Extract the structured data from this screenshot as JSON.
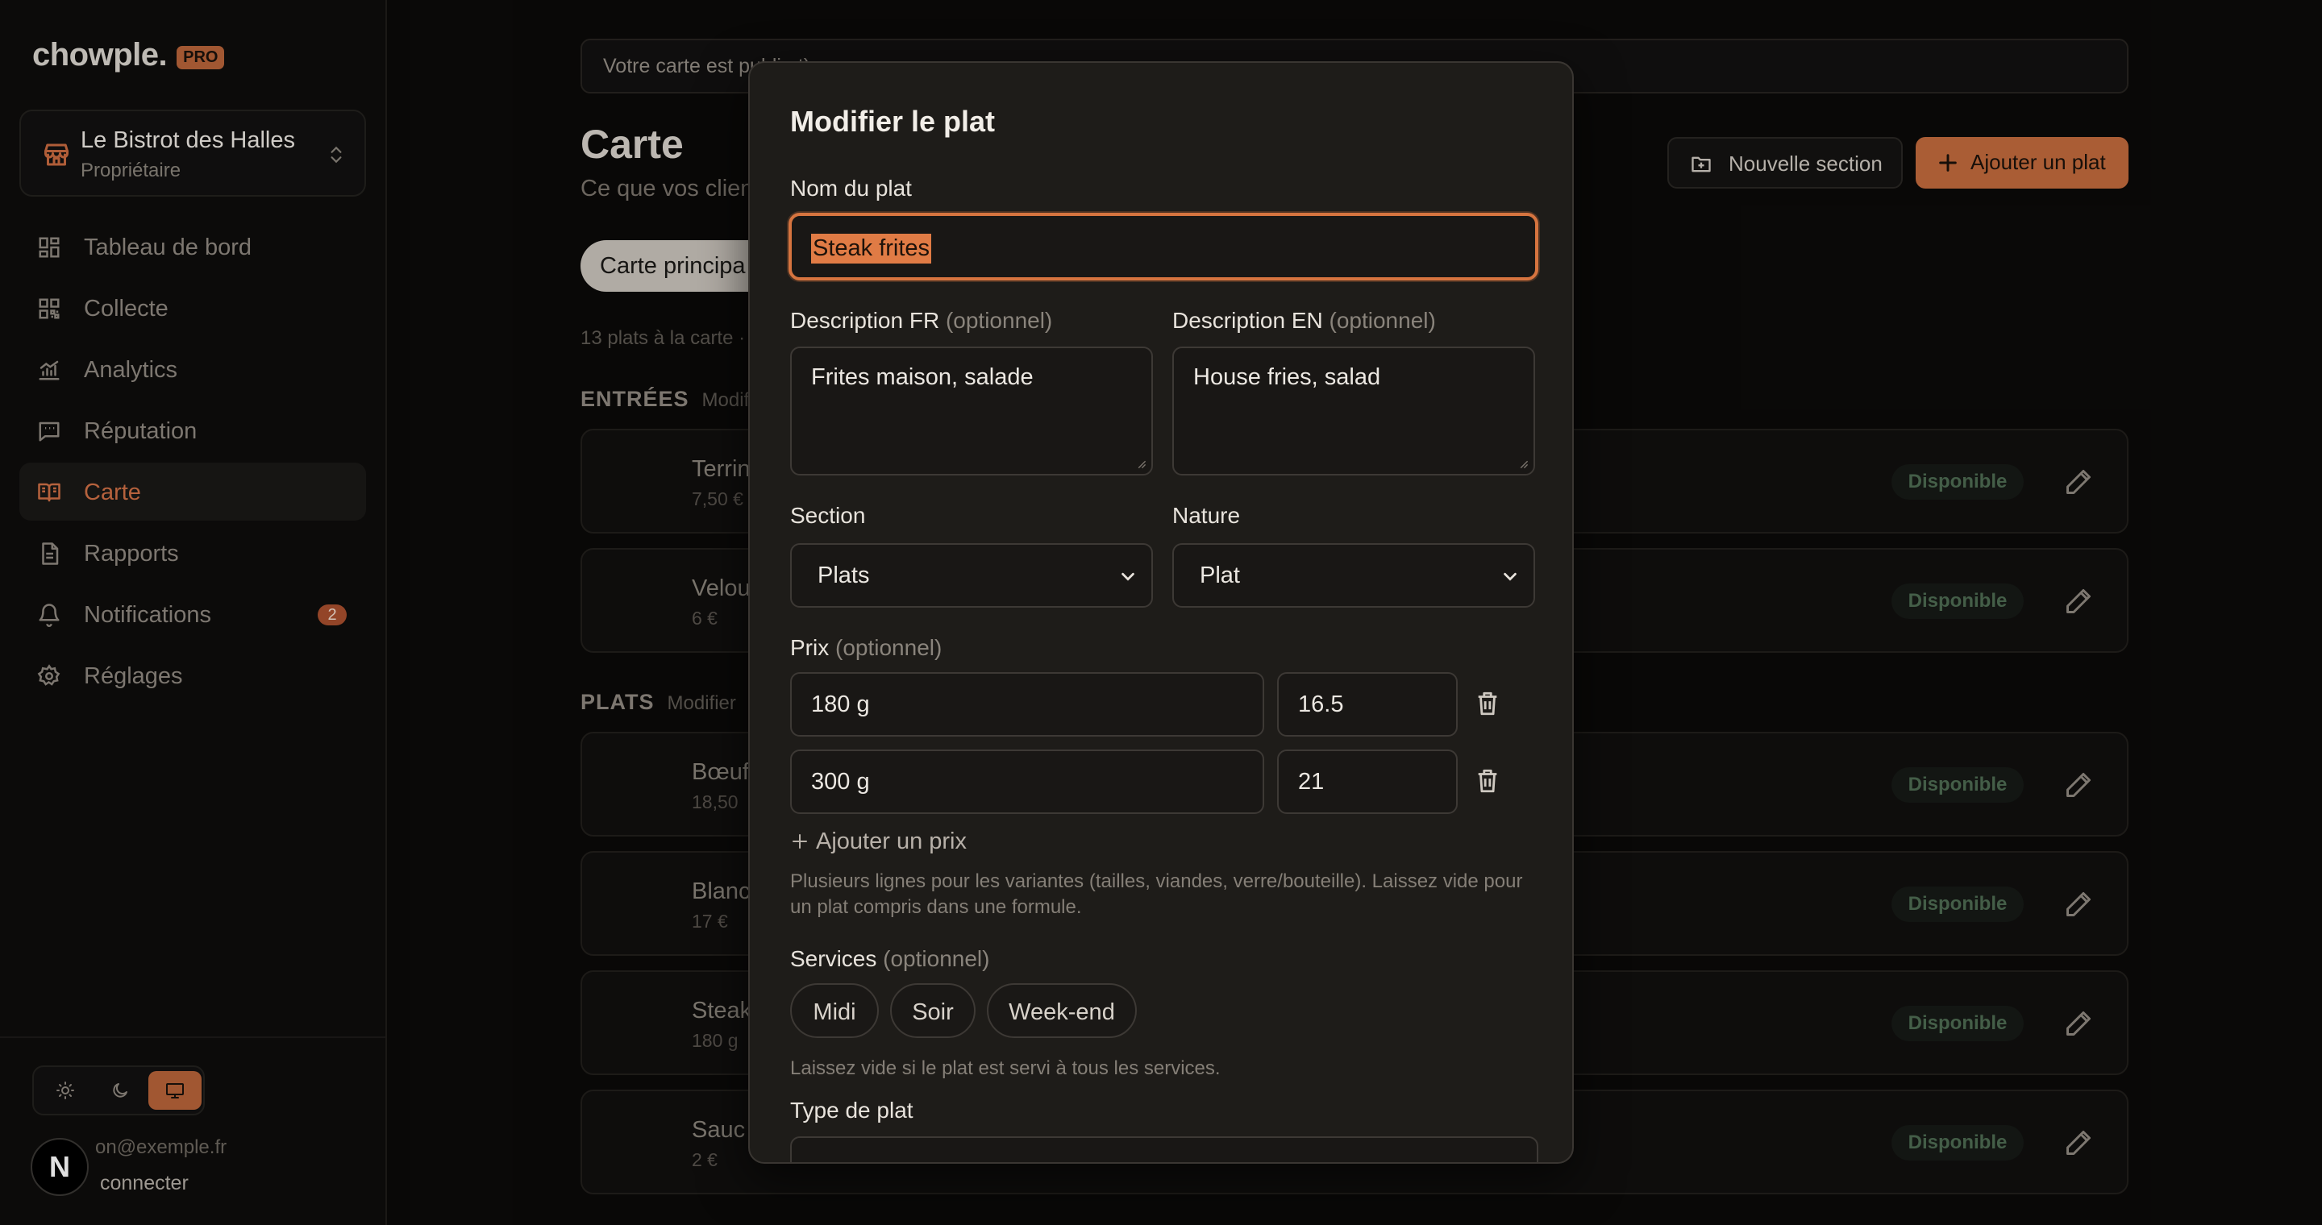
{
  "app": {
    "logo": "chowple.",
    "logo_badge": "PRO"
  },
  "venue": {
    "name": "Le Bistrot des Halles",
    "role": "Propriétaire"
  },
  "nav": [
    {
      "label": "Tableau de bord",
      "icon": "dashboard-icon"
    },
    {
      "label": "Collecte",
      "icon": "qr-code-icon"
    },
    {
      "label": "Analytics",
      "icon": "chart-icon"
    },
    {
      "label": "Réputation",
      "icon": "message-icon"
    },
    {
      "label": "Carte",
      "icon": "book-icon",
      "active": true
    },
    {
      "label": "Rapports",
      "icon": "document-icon"
    },
    {
      "label": "Notifications",
      "icon": "bell-icon",
      "badge": "2"
    },
    {
      "label": "Réglages",
      "icon": "gear-icon"
    }
  ],
  "user": {
    "email": "on@exemple.fr",
    "logout": "connecter"
  },
  "next_badge": "N",
  "main": {
    "notice": "Votre carte est publi                                                                                            nt).",
    "title": "Carte",
    "subtitle": "Ce que vos clien",
    "add_section": "Nouvelle section",
    "add_dish": "Ajouter un plat",
    "tab": "Carte principa",
    "count": "13 plats à la carte · V",
    "sections": [
      {
        "name": "ENTRÉES",
        "edit": "Modif"
      },
      {
        "name": "PLATS",
        "edit": "Modifier"
      }
    ],
    "dishes": [
      {
        "name": "Terrin",
        "price": "7,50 €",
        "status": "Disponible"
      },
      {
        "name": "Velou",
        "price": "6 €",
        "status": "Disponible"
      },
      {
        "name": "Bœuf",
        "price": "18,50",
        "status": "Disponible"
      },
      {
        "name": "Blanc",
        "price": "17 €",
        "status": "Disponible"
      },
      {
        "name": "Steak",
        "price": "180 g",
        "status": "Disponible"
      },
      {
        "name": "Sauc",
        "price": "2 €",
        "status": "Disponible"
      }
    ]
  },
  "modal": {
    "title": "Modifier le plat",
    "name_label": "Nom du plat",
    "name_value": "Steak frites",
    "desc_fr_label": "Description FR",
    "desc_en_label": "Description EN",
    "optional": "(optionnel)",
    "desc_fr_value": "Frites maison, salade",
    "desc_en_value": "House fries, salad",
    "section_label": "Section",
    "section_value": "Plats",
    "nature_label": "Nature",
    "nature_value": "Plat",
    "price_label": "Prix",
    "prices": [
      {
        "variant": "180 g",
        "amount": "16.5"
      },
      {
        "variant": "300 g",
        "amount": "21"
      }
    ],
    "add_price": "Ajouter un prix",
    "price_help": "Plusieurs lignes pour les variantes (tailles, viandes, verre/bouteille). Laissez vide pour un plat compris dans une formule.",
    "services_label": "Services",
    "services": [
      "Midi",
      "Soir",
      "Week-end"
    ],
    "services_help": "Laissez vide si le plat est servi à tous les services.",
    "type_label": "Type de plat"
  },
  "colors": {
    "accent": "#c26a3d",
    "background": "#0b0a09",
    "modal": "#1e1c19",
    "available": "#4e6b52"
  }
}
